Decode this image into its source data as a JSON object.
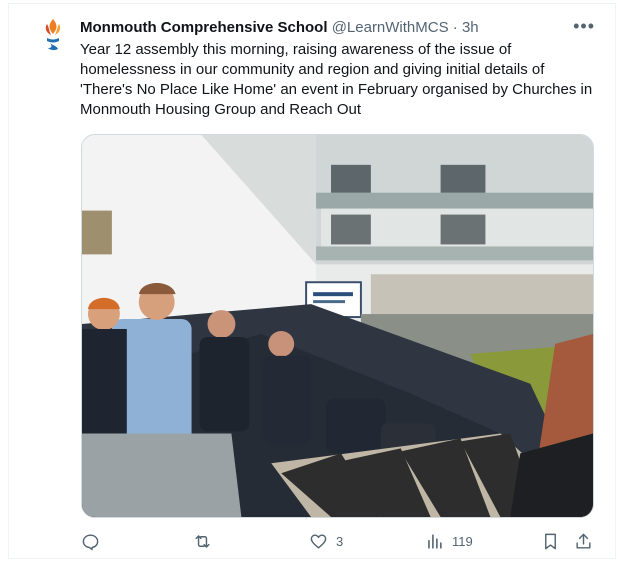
{
  "tweet": {
    "author_name": "Monmouth Comprehensive School",
    "handle": "@LearnWithMCS",
    "separator": "·",
    "time": "3h",
    "more_label": "•••",
    "text": "Year 12 assembly this morning, raising awareness of the issue of homelessness in our community and region and giving initial details of 'There's No Place Like Home' an event in February organised  by Churches in Monmouth Housing Group and Reach Out"
  },
  "actions": {
    "reply_icon": "reply-icon",
    "retweet_icon": "retweet-icon",
    "like_icon": "heart-icon",
    "like_count": "3",
    "views_icon": "views-icon",
    "views_count": "119",
    "bookmark_icon": "bookmark-icon",
    "share_icon": "share-icon"
  },
  "colors": {
    "text_primary": "#0f1419",
    "text_secondary": "#536471",
    "border": "#eff3f4"
  }
}
